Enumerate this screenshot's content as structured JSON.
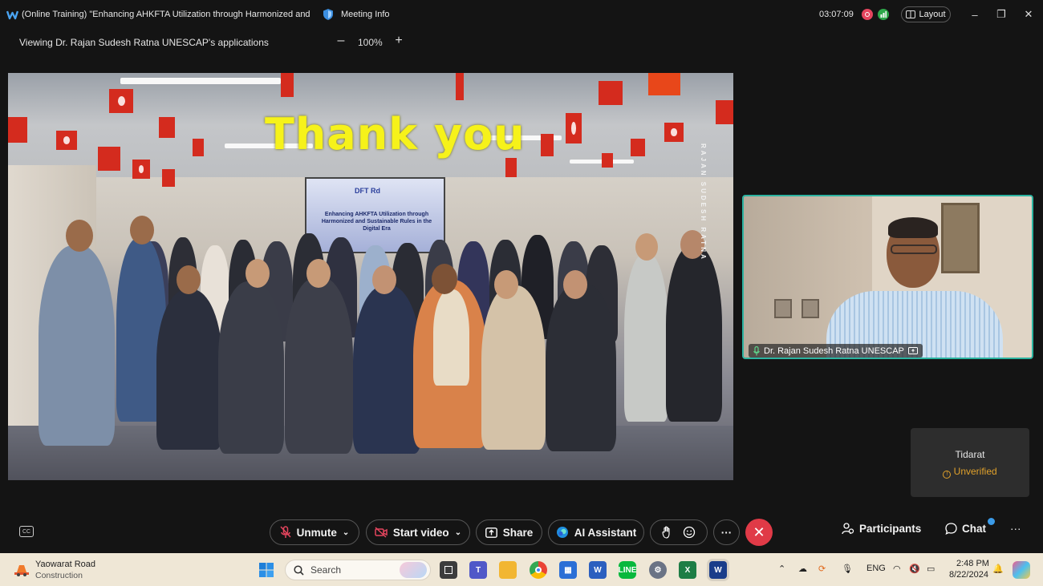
{
  "window": {
    "title": "(Online Training) \"Enhancing AHKFTA Utilization through Harmonized and S...",
    "meeting_info": "Meeting Info",
    "timer": "03:07:09",
    "layout_label": "Layout",
    "minimize": "–",
    "restore": "❐",
    "close": "✕"
  },
  "viewbar": {
    "viewing_text": "Viewing Dr. Rajan Sudesh Ratna UNESCAP's applications",
    "zoom_out": "–",
    "zoom_level": "100%",
    "zoom_in": "+"
  },
  "shared_content": {
    "headline": "Thank you",
    "vertical_credit": "RAJAN SUDESH RATNA",
    "screen_text": "Enhancing AHKFTA Utilization through Harmonized and Sustainable Rules in the Digital Era",
    "screen_logo": "DFT Rd"
  },
  "participants": {
    "main_video": {
      "name": "Dr. Rajan Sudesh Ratna UNESCAP"
    },
    "tile": {
      "name": "Tidarat",
      "status": "Unverified"
    }
  },
  "controls": {
    "unmute": "Unmute",
    "start_video": "Start video",
    "share": "Share",
    "ai_assistant": "AI Assistant",
    "more": "···",
    "participants": "Participants",
    "chat": "Chat",
    "overflow": "···"
  },
  "taskbar": {
    "weather_title": "Yaowarat Road",
    "weather_sub": "Construction",
    "search_placeholder": "Search",
    "lang": "ENG",
    "time": "2:48 PM",
    "date": "8/22/2024"
  },
  "colors": {
    "accent_teal": "#2bb3a0",
    "end_call_red": "#e03a47",
    "headline_yellow": "#f6f21a",
    "unverified_orange": "#e0a12b"
  }
}
